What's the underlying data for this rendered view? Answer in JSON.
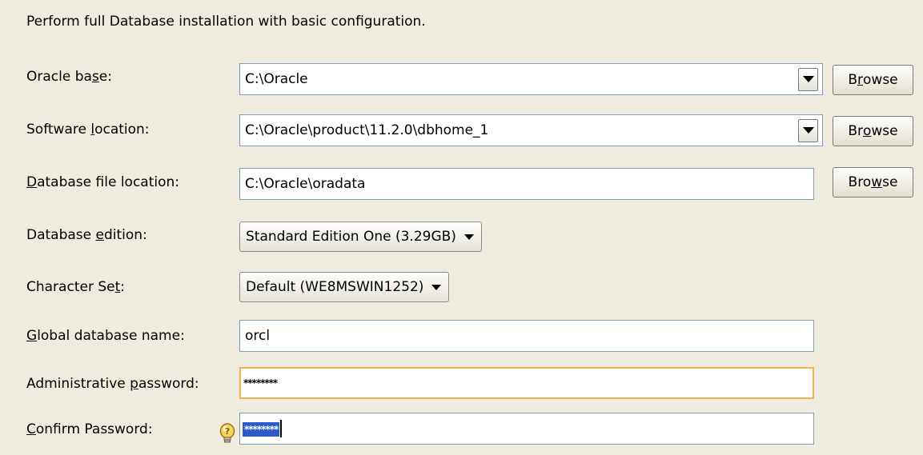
{
  "intro": "Perform full Database installation with basic configuration.",
  "fields": {
    "oracle_base": {
      "label_pre": "Oracle ba",
      "label_mn": "s",
      "label_post": "e:",
      "value": "C:\\Oracle"
    },
    "software_location": {
      "label_pre": "Software ",
      "label_mn": "l",
      "label_post": "ocation:",
      "value": "C:\\Oracle\\product\\11.2.0\\dbhome_1"
    },
    "db_file_location": {
      "label_pre": "",
      "label_mn": "D",
      "label_post": "atabase file location:",
      "value": "C:\\Oracle\\oradata"
    },
    "db_edition": {
      "label_pre": "Database ",
      "label_mn": "e",
      "label_post": "dition:",
      "value": "Standard Edition One (3.29GB)"
    },
    "charset": {
      "label_pre": "Character Se",
      "label_mn": "t",
      "label_post": ":",
      "value": "Default (WE8MSWIN1252)"
    },
    "global_db_name": {
      "label_pre": "",
      "label_mn": "G",
      "label_post": "lobal database name:",
      "value": "orcl"
    },
    "admin_password": {
      "label_pre": "Administrative ",
      "label_mn": "p",
      "label_post": "assword:",
      "value": "********"
    },
    "confirm_password": {
      "label_pre": "",
      "label_mn": "C",
      "label_post": "onfirm Password:",
      "value": "********"
    }
  },
  "browse1": {
    "pre": "B",
    "mn": "r",
    "post": "owse"
  },
  "browse2": {
    "pre": "Br",
    "mn": "o",
    "post": "wse"
  },
  "browse3": {
    "pre": "Bro",
    "mn": "w",
    "post": "se"
  },
  "icons": {
    "hint": "hint-bulb-icon",
    "combo_arrow": "chevron-down-icon"
  },
  "colors": {
    "background": "#efebde",
    "focus_border": "#f5b04a",
    "selection": "#2a5bc8"
  }
}
